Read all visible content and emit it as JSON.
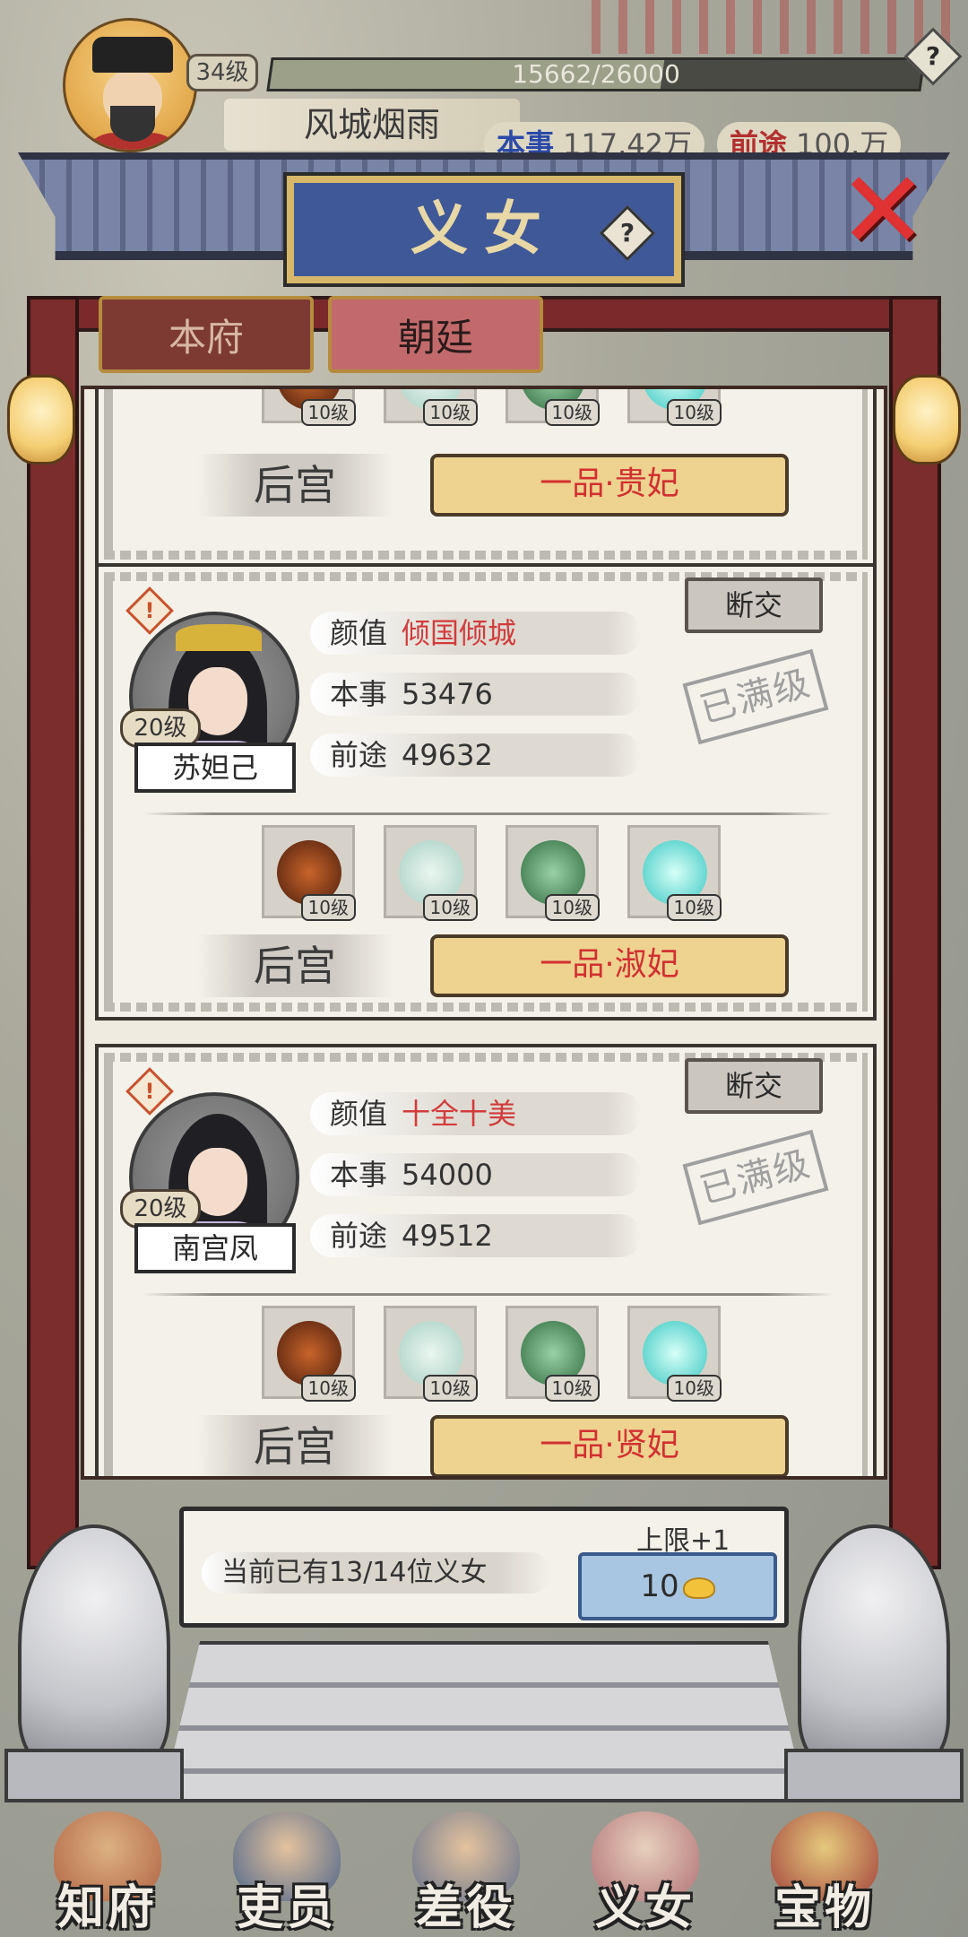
{
  "player": {
    "level": "34级",
    "exp_text": "15662/26000",
    "exp_fraction": 0.602,
    "name": "风城烟雨",
    "stats": [
      {
        "label": "本事",
        "value": "117.42万"
      },
      {
        "label": "前途",
        "value": "100.万"
      }
    ]
  },
  "window": {
    "title": "义女",
    "help_symbol": "?",
    "close_symbol": "✕"
  },
  "tabs": [
    {
      "label": "本府",
      "active": false
    },
    {
      "label": "朝廷",
      "active": true
    }
  ],
  "cards": [
    {
      "partial": true,
      "items": [
        {
          "icon": "bead-bracelet-icon",
          "level": "10级"
        },
        {
          "icon": "robe-icon",
          "level": "10级"
        },
        {
          "icon": "jade-dragon-icon",
          "level": "10级"
        },
        {
          "icon": "crystal-ball-icon",
          "level": "10级"
        }
      ],
      "destination": "后宫",
      "rank": "一品·贵妃"
    },
    {
      "name": "苏妲己",
      "level": "20级",
      "warn_symbol": "!",
      "stats": [
        {
          "label": "颜值",
          "value": "倾国倾城",
          "highlight": true
        },
        {
          "label": "本事",
          "value": "53476",
          "highlight": false
        },
        {
          "label": "前途",
          "value": "49632",
          "highlight": false
        }
      ],
      "breakup_label": "断交",
      "max_stamp": "已满级",
      "items": [
        {
          "icon": "bead-bracelet-icon",
          "level": "10级"
        },
        {
          "icon": "robe-icon",
          "level": "10级"
        },
        {
          "icon": "jade-dragon-icon",
          "level": "10级"
        },
        {
          "icon": "crystal-ball-icon",
          "level": "10级"
        }
      ],
      "destination": "后宫",
      "rank": "一品·淑妃"
    },
    {
      "name": "南宫凤",
      "level": "20级",
      "warn_symbol": "!",
      "stats": [
        {
          "label": "颜值",
          "value": "十全十美",
          "highlight": true
        },
        {
          "label": "本事",
          "value": "54000",
          "highlight": false
        },
        {
          "label": "前途",
          "value": "49512",
          "highlight": false
        }
      ],
      "breakup_label": "断交",
      "max_stamp": "已满级",
      "items": [
        {
          "icon": "bead-bracelet-icon",
          "level": "10级"
        },
        {
          "icon": "robe-icon",
          "level": "10级"
        },
        {
          "icon": "jade-dragon-icon",
          "level": "10级"
        },
        {
          "icon": "crystal-ball-icon",
          "level": "10级"
        }
      ],
      "destination": "后宫",
      "rank": "一品·贤妃"
    }
  ],
  "footer": {
    "count_text": "当前已有13/14位义女",
    "limit_label": "上限+1",
    "limit_cost": "10",
    "currency_icon": "gold-ingot-icon"
  },
  "nav": [
    {
      "label": "知府",
      "icon": "magistrate-icon"
    },
    {
      "label": "吏员",
      "icon": "clerk-icon"
    },
    {
      "label": "差役",
      "icon": "runner-icon"
    },
    {
      "label": "义女",
      "icon": "daughter-icon"
    },
    {
      "label": "宝物",
      "icon": "treasure-icon"
    }
  ],
  "colors": {
    "highlight_red": "#d23b3b",
    "plaque_blue": "#3f5897",
    "rank_gold": "#eed290"
  }
}
